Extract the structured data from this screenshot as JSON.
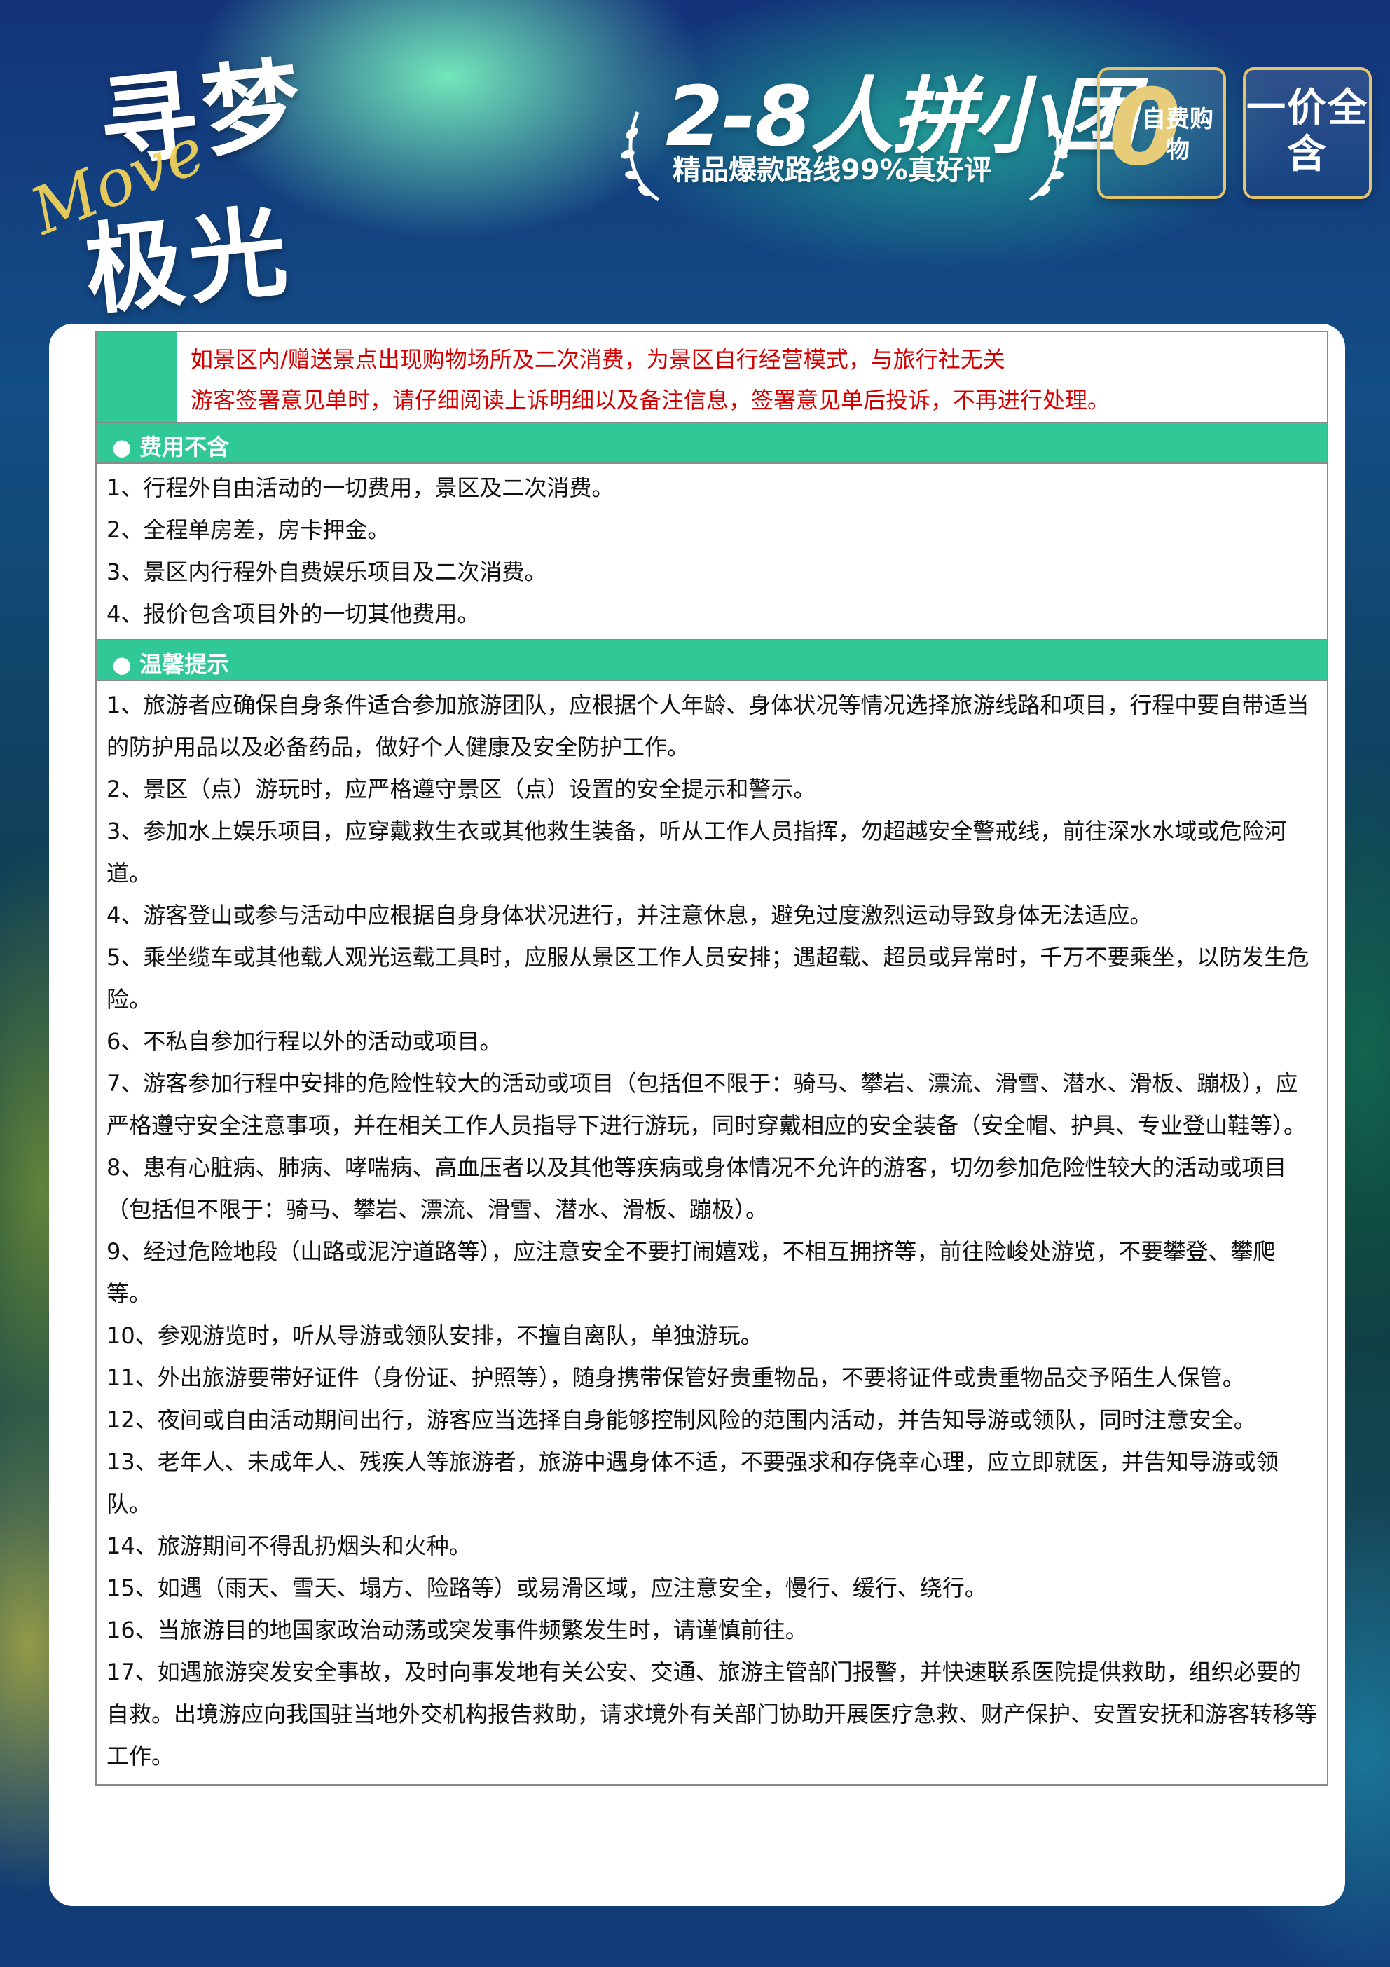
{
  "header": {
    "brand_line1": "寻梦",
    "brand_line2": "极光",
    "brand_script": "Move",
    "group_title": "2-8人拼小团",
    "group_subtitle": "精品爆款路线99%真好评",
    "badge_self_shop_letter": "0",
    "badge_self_shop_text": "自费购物",
    "badge_all_inclusive": "一价全含"
  },
  "notice": {
    "line1": "如景区内/赠送景点出现购物场所及二次消费，为景区自行经营模式，与旅行社无关",
    "line2": "游客签署意见单时，请仔细阅读上诉明细以及备注信息，签署意见单后投诉，不再进行处理。"
  },
  "fees_excluded": {
    "title": "● 费用不含",
    "items": [
      "1、行程外自由活动的一切费用，景区及二次消费。",
      "2、全程单房差，房卡押金。",
      "3、景区内行程外自费娱乐项目及二次消费。",
      "4、报价包含项目外的一切其他费用。"
    ]
  },
  "tips": {
    "title": "● 温馨提示",
    "items": [
      "1、旅游者应确保自身条件适合参加旅游团队，应根据个人年龄、身体状况等情况选择旅游线路和项目，行程中要自带适当的防护用品以及必备药品，做好个人健康及安全防护工作。",
      "2、景区（点）游玩时，应严格遵守景区（点）设置的安全提示和警示。",
      "3、参加水上娱乐项目，应穿戴救生衣或其他救生装备，听从工作人员指挥，勿超越安全警戒线，前往深水水域或危险河道。",
      "4、游客登山或参与活动中应根据自身身体状况进行，并注意休息，避免过度激烈运动导致身体无法适应。",
      "5、乘坐缆车或其他载人观光运载工具时，应服从景区工作人员安排；遇超载、超员或异常时，千万不要乘坐，以防发生危险。",
      "6、不私自参加行程以外的活动或项目。",
      "7、游客参加行程中安排的危险性较大的活动或项目（包括但不限于：骑马、攀岩、漂流、滑雪、潜水、滑板、蹦极），应严格遵守安全注意事项，并在相关工作人员指导下进行游玩，同时穿戴相应的安全装备（安全帽、护具、专业登山鞋等）。",
      "8、患有心脏病、肺病、哮喘病、高血压者以及其他等疾病或身体情况不允许的游客，切勿参加危险性较大的活动或项目（包括但不限于：骑马、攀岩、漂流、滑雪、潜水、滑板、蹦极）。",
      "9、经过危险地段（山路或泥泞道路等），应注意安全不要打闹嬉戏，不相互拥挤等，前往险峻处游览，不要攀登、攀爬等。",
      "10、参观游览时，听从导游或领队安排，不擅自离队，单独游玩。",
      "11、外出旅游要带好证件（身份证、护照等），随身携带保管好贵重物品，不要将证件或贵重物品交予陌生人保管。",
      "12、夜间或自由活动期间出行，游客应当选择自身能够控制风险的范围内活动，并告知导游或领队，同时注意安全。",
      "13、老年人、未成年人、残疾人等旅游者，旅游中遇身体不适，不要强求和存侥幸心理，应立即就医，并告知导游或领队。",
      "14、旅游期间不得乱扔烟头和火种。",
      "15、如遇（雨天、雪天、塌方、险路等）或易滑区域，应注意安全，慢行、缓行、绕行。",
      "16、当旅游目的地国家政治动荡或突发事件频繁发生时，请谨慎前往。",
      "17、如遇旅游突发安全事故，及时向事发地有关公安、交通、旅游主管部门报警，并快速联系医院提供救助，组织必要的自救。出境游应向我国驻当地外交机构报告救助，请求境外有关部门协助开展医疗急救、财产保护、安置安抚和游客转移等工作。"
    ]
  },
  "colors": {
    "accent_green": "#2fc896",
    "notice_red": "#d40000",
    "badge_gold": "#e3c46c"
  }
}
